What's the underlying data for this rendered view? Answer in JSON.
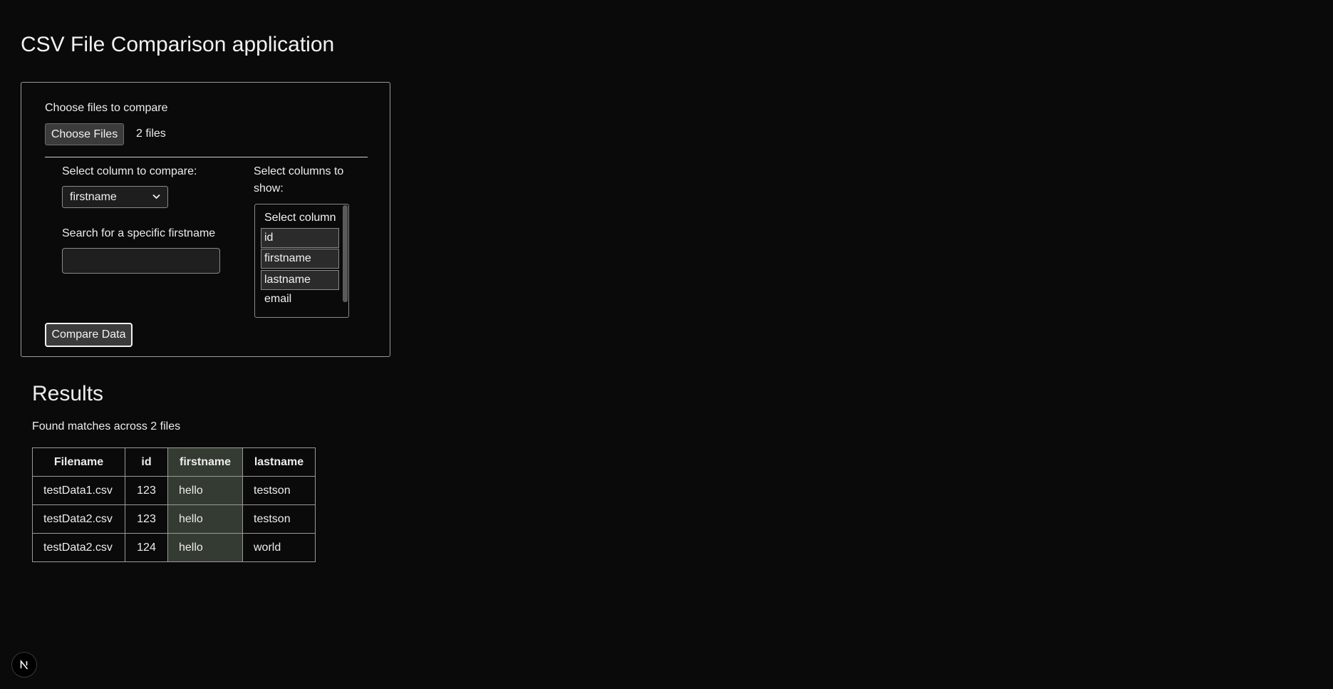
{
  "app": {
    "title": "CSV File Comparison application"
  },
  "upload": {
    "label": "Choose files to compare",
    "button_label": "Choose Files",
    "file_count_text": "2 files"
  },
  "compare_column": {
    "label": "Select column to compare:",
    "selected": "firstname"
  },
  "search": {
    "label": "Search for a specific firstname",
    "value": ""
  },
  "show_columns": {
    "label": "Select columns to show:",
    "options": [
      {
        "label": "Select column",
        "selected": false
      },
      {
        "label": "id",
        "selected": true
      },
      {
        "label": "firstname",
        "selected": true
      },
      {
        "label": "lastname",
        "selected": true
      },
      {
        "label": "email",
        "selected": false
      }
    ]
  },
  "compare_button": {
    "label": "Compare Data"
  },
  "results": {
    "heading": "Results",
    "summary": "Found matches across 2 files",
    "columns": [
      "Filename",
      "id",
      "firstname",
      "lastname"
    ],
    "highlighted_column": "firstname",
    "rows": [
      [
        "testData1.csv",
        "123",
        "hello",
        "testson"
      ],
      [
        "testData2.csv",
        "123",
        "hello",
        "testson"
      ],
      [
        "testData2.csv",
        "124",
        "hello",
        "world"
      ]
    ]
  },
  "colors": {
    "background": "#0a0a0a",
    "highlight_column": "#343b32"
  },
  "icons": {
    "framework_badge": "next-logo-icon"
  }
}
